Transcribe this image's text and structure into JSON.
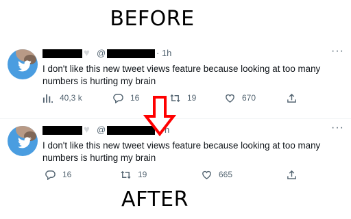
{
  "labels": {
    "before": "BEFORE",
    "after": "AFTER"
  },
  "before": {
    "at": "@",
    "time": "· 1h",
    "text": "I don't like this new tweet views feature because looking at too many numbers is hurting my brain",
    "views": "40,3 k",
    "replies": "16",
    "retweets": "19",
    "likes": "670",
    "more": "···"
  },
  "after": {
    "at": "@",
    "time": "h",
    "text": "I don't like this new tweet views feature because looking at too many numbers is hurting my brain",
    "replies": "16",
    "retweets": "19",
    "likes": "665",
    "more": "···"
  },
  "colors": {
    "arrow": "#ff0000",
    "muted": "#536471",
    "text": "#0f1419",
    "avatar": "#4a9de0"
  },
  "icons": [
    "views-icon",
    "reply-icon",
    "retweet-icon",
    "like-icon",
    "share-icon",
    "more-icon",
    "heart-icon",
    "down-arrow"
  ]
}
